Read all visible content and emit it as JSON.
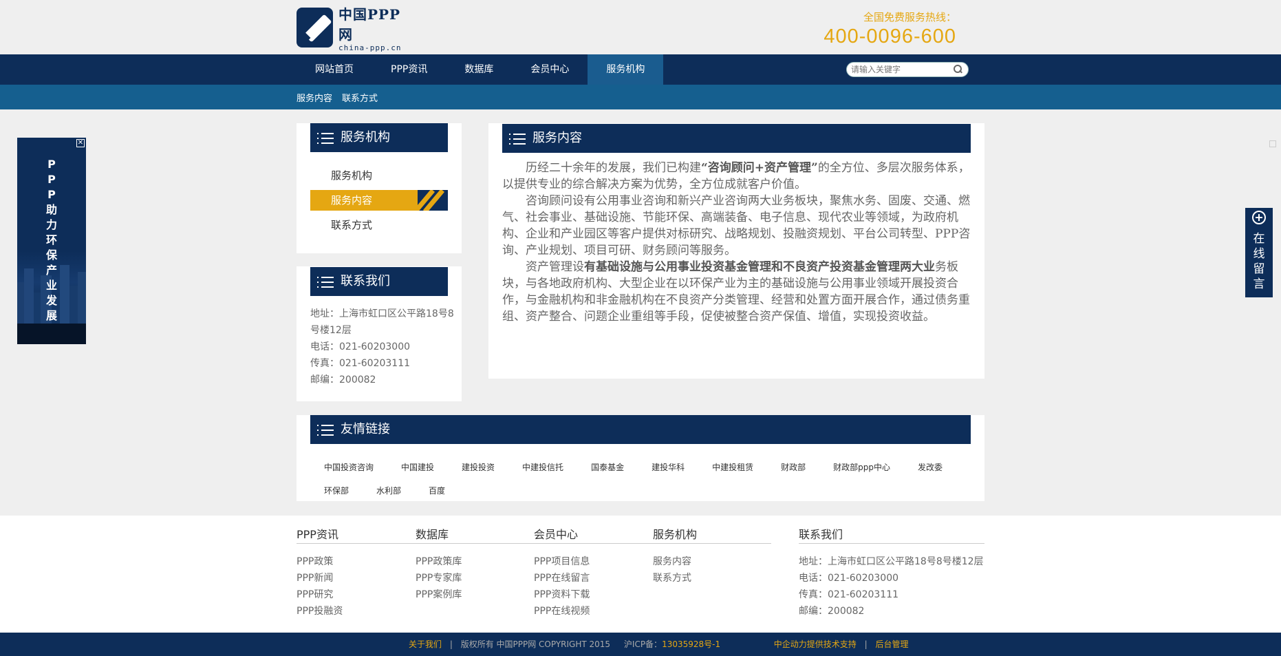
{
  "header": {
    "logo_cn": "中国PPP网",
    "logo_en": "china-ppp.cn",
    "hotline_label": "全国免费服务热线：",
    "hotline_number": "400-0096-600"
  },
  "nav": {
    "items": [
      "网站首页",
      "PPP资讯",
      "数据库",
      "会员中心",
      "服务机构"
    ],
    "active_index": 4,
    "search_placeholder": "请输入关键字"
  },
  "subnav": {
    "items": [
      "服务内容",
      "联系方式"
    ]
  },
  "side_ad": {
    "chars": [
      "P",
      "P",
      "P",
      "助",
      "力",
      "环",
      "保",
      "产",
      "业",
      "发",
      "展"
    ],
    "close": "✕"
  },
  "sidebar": {
    "org_title": "服务机构",
    "org_links": [
      "服务机构",
      "服务内容",
      "联系方式"
    ],
    "org_active_index": 1,
    "contact_title": "联系我们",
    "address": "地址：上海市虹口区公平路18号8号楼12层",
    "phone": "电话：021-60203000",
    "fax": "传真：021-60203111",
    "postcode": "邮编：200082"
  },
  "main": {
    "title": "服务内容",
    "p1_pre": "历经二十余年的发展，我们已构建",
    "p1_bold": "“咨询顾问+资产管理”",
    "p1_post": "的全方位、多层次服务体系，以提供专业的综合解决方案为优势，全方位成就客户价值。",
    "p2": "咨询顾问设有公用事业咨询和新兴产业咨询两大业务板块，聚焦水务、固废、交通、燃气、社会事业、基础设施、节能环保、高端装备、电子信息、现代农业等领域，为政府机构、企业和产业园区等客户提供对标研究、战略规划、投融资规划、平台公司转型、PPP咨询、产业规划、项目可研、财务顾问等服务。",
    "p3_pre": "资产管理设",
    "p3_bold": "有基础设施与公用事业投资基金管理和不良资产投资基金管理两大业",
    "p3_post": "务板块，与各地政府机构、大型企业在以环保产业为主的基础设施与公用事业领域开展投资合作，与金融机构和非金融机构在不良资产分类管理、经营和处置方面开展合作，通过债务重组、资产整合、问题企业重组等手段，促使被整合资产保值、增值，实现投资收益。"
  },
  "friend_links": {
    "title": "友情链接",
    "row1": [
      "中国投资咨询",
      "中国建投",
      "建投投资",
      "中建投信托",
      "国泰基金",
      "建投华科",
      "中建投租赁",
      "财政部",
      "财政部ppp中心",
      "发改委"
    ],
    "row2": [
      "环保部",
      "水利部",
      "百度"
    ]
  },
  "footer": {
    "col1": {
      "title": "PPP资讯",
      "items": [
        "PPP政策",
        "PPP新闻",
        "PPP研究",
        "PPP投融资"
      ]
    },
    "col2": {
      "title": "数据库",
      "items": [
        "PPP政策库",
        "PPP专家库",
        "PPP案例库"
      ]
    },
    "col3": {
      "title": "会员中心",
      "items": [
        "PPP项目信息",
        "PPP在线留言",
        "PPP资料下载",
        "PPP在线视频"
      ]
    },
    "col4": {
      "title": "服务机构",
      "items": [
        "服务内容",
        "联系方式"
      ]
    },
    "col5": {
      "title": "联系我们",
      "items": [
        "地址：上海市虹口区公平路18号8号楼12层",
        "电话：021-60203000",
        "传真：021-60203111",
        "邮编：200082"
      ]
    }
  },
  "bottom": {
    "about": "关于我们",
    "copyright": "版权所有 中国PPP网 COPYRIGHT 2015",
    "icp_label": "沪ICP备：",
    "icp_num": "13035928号-1",
    "tech": "中企动力提供技术支持",
    "admin": "后台管理"
  },
  "float_msg": {
    "chars": [
      "在",
      "线",
      "留",
      "言"
    ]
  },
  "colors": {
    "navy": "#0d2d59",
    "blue": "#155f8f",
    "gold": "#e5a712"
  }
}
